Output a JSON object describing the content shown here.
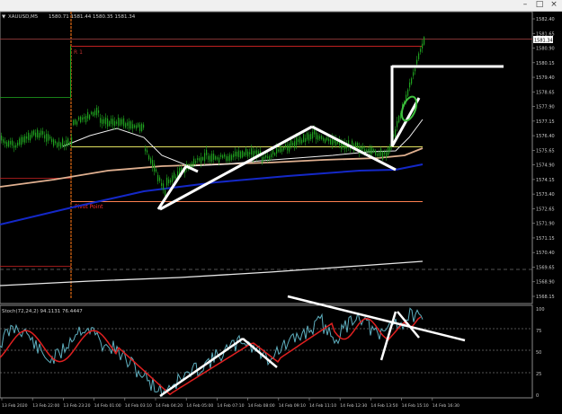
{
  "window": {
    "minimize_glyph": "–",
    "maximize_glyph": "□",
    "close_glyph": "×"
  },
  "header": {
    "symbol": "XAUUSD,M5",
    "ohlc": "1580.71 1581.44 1580.35 1581.34"
  },
  "price_axis": {
    "ticks": [
      "1582.40",
      "1581.65",
      "1580.90",
      "1580.15",
      "1579.40",
      "1578.65",
      "1577.90",
      "1577.15",
      "1576.40",
      "1575.65",
      "1574.90",
      "1574.15",
      "1573.40",
      "1572.65",
      "1571.90",
      "1571.15",
      "1570.40",
      "1569.65",
      "1568.90",
      "1568.15"
    ],
    "current_price": "1581.34",
    "colors": {
      "current_bg": "#ffffff",
      "current_text": "#000000"
    }
  },
  "pivots": {
    "r1_label": "R 1",
    "pivot_label": "Pivot Point",
    "colors": {
      "r1": "#c02020",
      "pivot": "#ff3030"
    }
  },
  "stoch": {
    "label": "Stoch(72,24,2) 94.1131 76.4447",
    "levels": [
      "100",
      "75",
      "50",
      "25",
      "0"
    ],
    "colors": {
      "main": "#5fb0c0",
      "signal": "#e02020"
    }
  },
  "time_axis": {
    "labels": [
      "13 Feb 2020",
      "13 Feb 22:00",
      "13 Feb 23:20",
      "14 Feb 01:00",
      "14 Feb 03:10",
      "14 Feb 04:20",
      "14 Feb 05:00",
      "14 Feb 07:10",
      "14 Feb 08:00",
      "14 Feb 09:10",
      "14 Feb 11:10",
      "14 Feb 12:30",
      "14 Feb 13:50",
      "14 Feb 15:10",
      "14 Feb 16:30"
    ]
  },
  "colors": {
    "candle_up": "#1fa01f",
    "ma_blue": "#1428c8",
    "ma_tan": "#e0b090",
    "ma_white": "#e8e8e8",
    "yellow_level": "#e0e060",
    "annotation": "#ffffff"
  }
}
